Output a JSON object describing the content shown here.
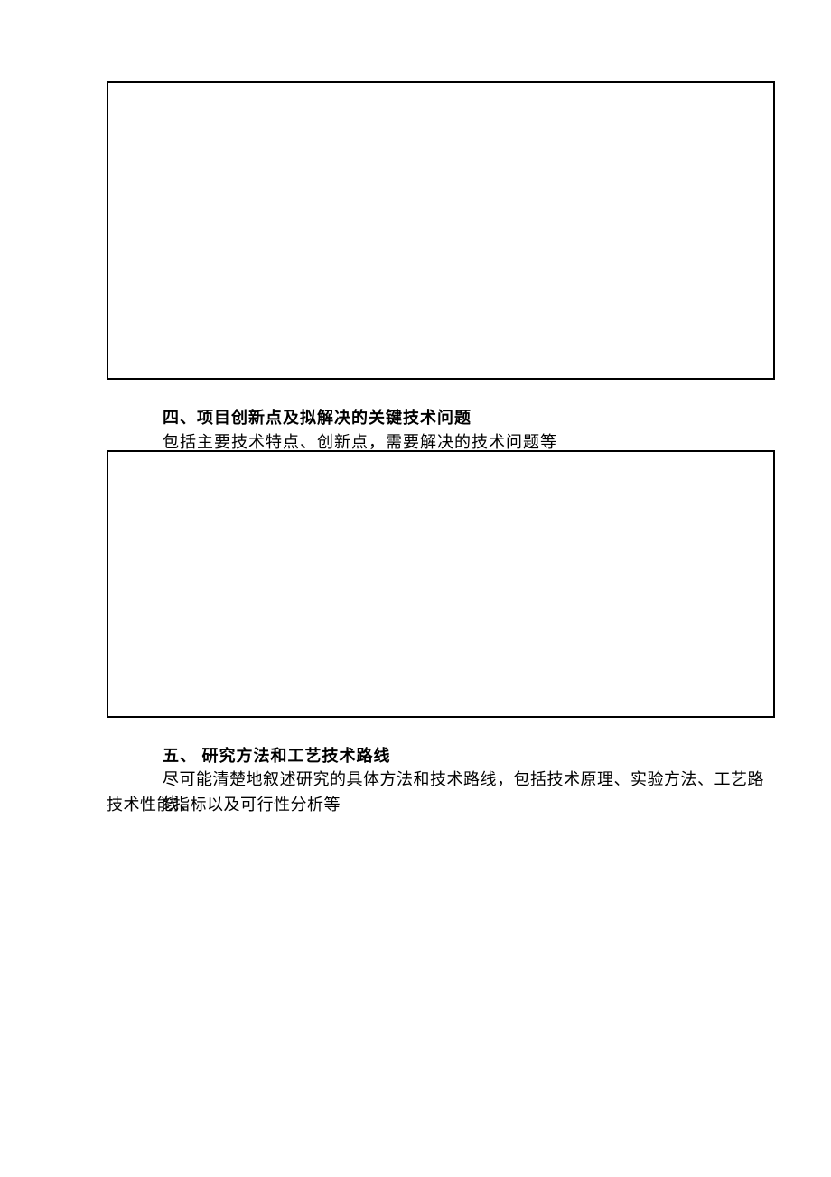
{
  "sections": {
    "four": {
      "heading": "四、项目创新点及拟解决的关键技术问题",
      "description": "包括主要技术特点、创新点，需要解决的技术问题等"
    },
    "five": {
      "heading": "五、 研究方法和工艺技术路线",
      "description_line1": "尽可能清楚地叙述研究的具体方法和技术路线，包括技术原理、实验方法、工艺路线、",
      "description_line2": "技术性能指标以及可行性分析等"
    }
  }
}
